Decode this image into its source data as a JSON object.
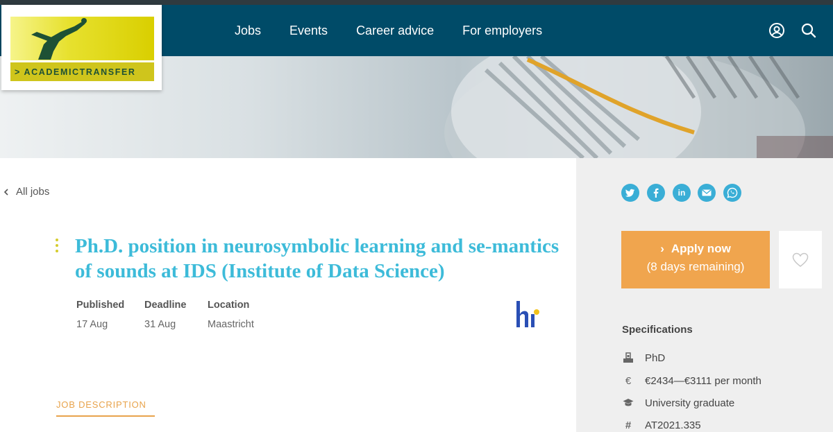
{
  "brand": {
    "logo_text": "> ACADEMICTRANSFER"
  },
  "nav": {
    "items": [
      {
        "label": "Jobs"
      },
      {
        "label": "Events"
      },
      {
        "label": "Career advice"
      },
      {
        "label": "For employers"
      }
    ],
    "account_icon": "user-circle-icon",
    "search_icon": "search-icon"
  },
  "back_link": {
    "label": "All jobs"
  },
  "job": {
    "title": "Ph.D. position in neurosymbolic learning and se-mantics of sounds at IDS (Institute of Data Science)",
    "published_label": "Published",
    "published_value": "17 Aug",
    "deadline_label": "Deadline",
    "deadline_value": "31 Aug",
    "location_label": "Location",
    "location_value": "Maastricht"
  },
  "tabs": {
    "job_description": "JOB DESCRIPTION"
  },
  "share": {
    "icons": [
      "twitter-icon",
      "facebook-icon",
      "linkedin-icon",
      "email-icon",
      "whatsapp-icon"
    ]
  },
  "apply": {
    "label": "Apply now",
    "remaining": "(8 days remaining)"
  },
  "specifications": {
    "title": "Specifications",
    "items": [
      {
        "icon": "degree-icon",
        "value": "PhD"
      },
      {
        "icon": "euro-icon",
        "value": "€2434—€3111 per month"
      },
      {
        "icon": "graduation-cap-icon",
        "value": "University graduate"
      },
      {
        "icon": "hash-icon",
        "value": "AT2021.335"
      }
    ]
  },
  "colors": {
    "navbar": "#004b68",
    "title": "#3dbbd9",
    "apply": "#f0a54e",
    "share": "#3aaed6"
  }
}
